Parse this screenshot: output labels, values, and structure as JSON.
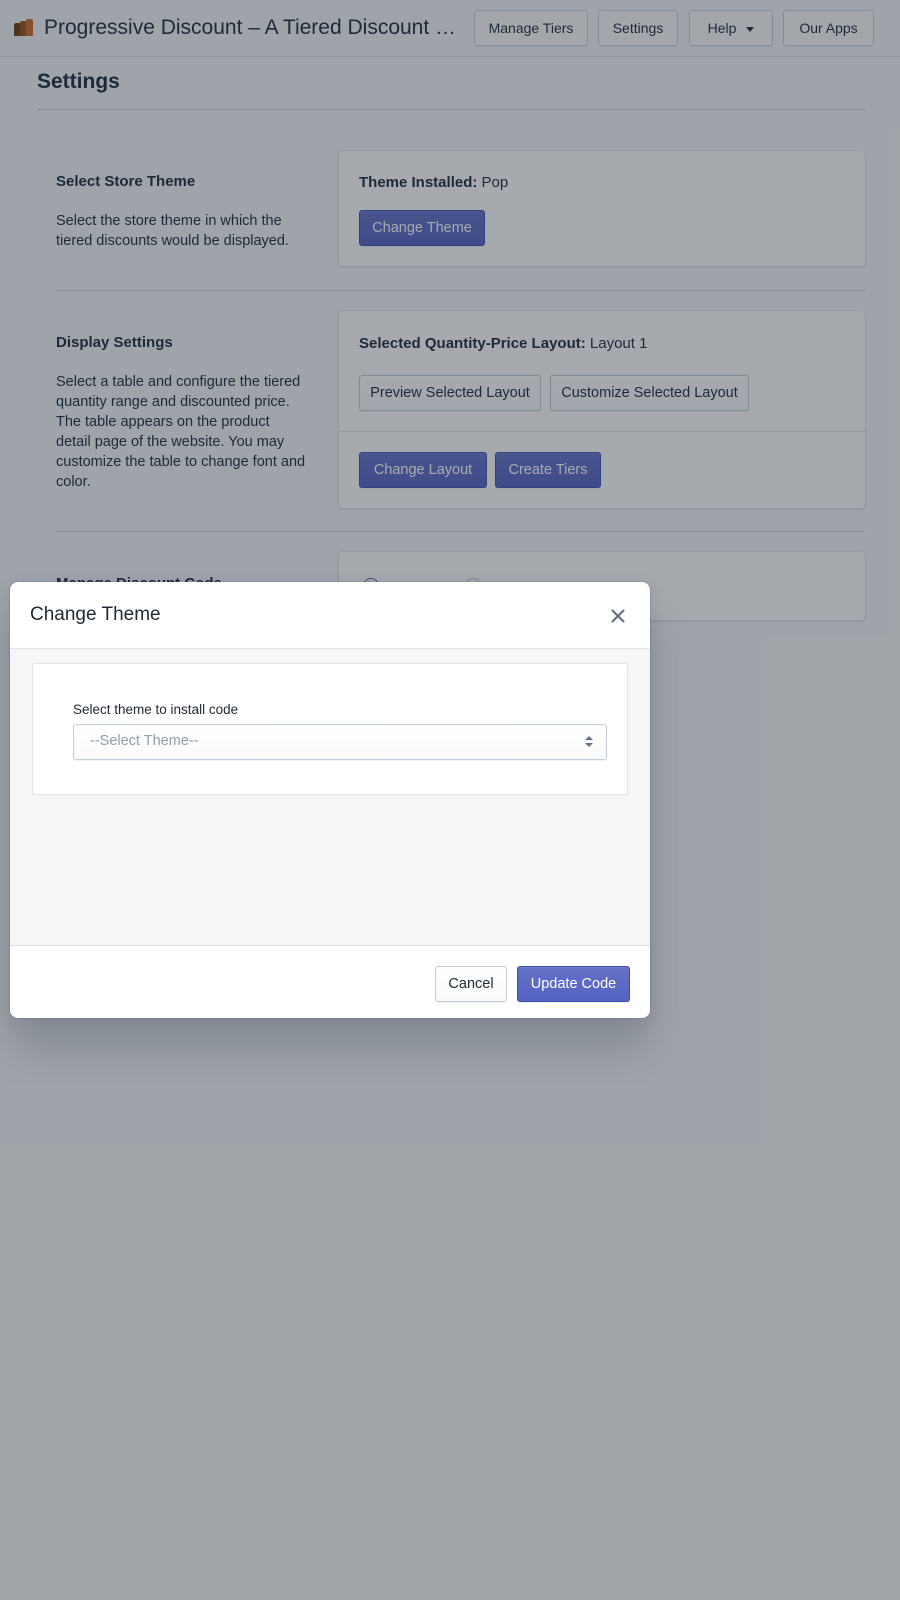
{
  "topbar": {
    "app_icon": "app-logo-icon",
    "title": "Progressive Discount – A Tiered Discount app...",
    "nav": [
      {
        "label": "Manage Tiers"
      },
      {
        "label": "Settings"
      },
      {
        "label": "Help",
        "icon": "caret-down-icon"
      },
      {
        "label": "Our Apps"
      }
    ]
  },
  "page": {
    "title": "Settings"
  },
  "sections": [
    {
      "title": "Select Store Theme",
      "description": "Select the store theme in which the tiered discounts would be displayed.",
      "card": {
        "label": "Theme Installed:",
        "value": " Pop",
        "button": "Change Theme"
      }
    },
    {
      "title": "Display Settings",
      "description": "Select a table and configure the tiered quantity range and discounted price. The table appears on the product detail page of the website. You may customize the table to change font and color.",
      "card": {
        "label": "Selected Quantity-Price Layout:",
        "value": " Layout 1",
        "buttons_secondary": [
          "Preview Selected Layout",
          "Customize Selected Layout"
        ],
        "buttons_primary": [
          "Change Layout",
          "Create Tiers"
        ]
      }
    },
    {
      "title": "Manage Discount Code"
    }
  ],
  "modal": {
    "title": "Change Theme",
    "close_icon": "close-icon",
    "field_label": "Select theme to install code",
    "select_placeholder": "--Select Theme--",
    "cancel": "Cancel",
    "submit": "Update Code"
  },
  "colors": {
    "primary": "#5c6ac4",
    "overlay": "rgba(33,43,54,0.4)",
    "background": "#f4f6f8"
  }
}
